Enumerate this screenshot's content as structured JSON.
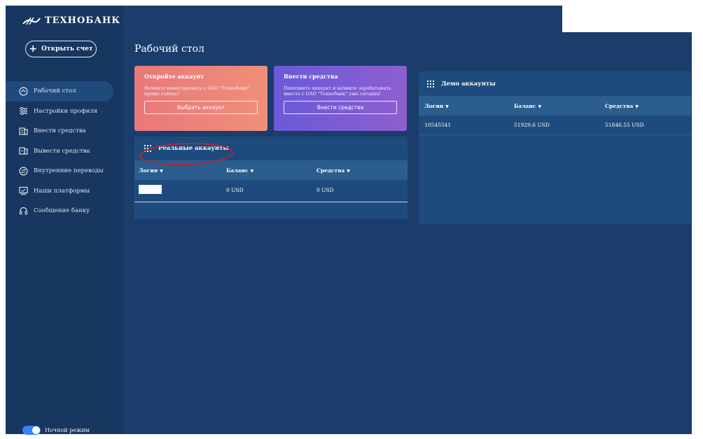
{
  "sidebar": {
    "logo": "ТЕХНОБАНК",
    "open_button": "Открыть счет",
    "items": [
      {
        "label": "Рабочий стол",
        "icon": "dashboard-icon"
      },
      {
        "label": "Настройки профиля",
        "icon": "sliders-icon"
      },
      {
        "label": "Внести средства",
        "icon": "deposit-icon"
      },
      {
        "label": "Вывести средства",
        "icon": "withdraw-icon"
      },
      {
        "label": "Внутренние переводы",
        "icon": "transfer-icon"
      },
      {
        "label": "Наши платформы",
        "icon": "platform-icon"
      },
      {
        "label": "Сообщение банку",
        "icon": "headset-icon"
      }
    ],
    "active_index": 0,
    "night_mode": {
      "label": "Ночной режим",
      "on": true
    }
  },
  "main": {
    "title": "Рабочий стол",
    "card_open": {
      "title": "Откройте аккаунт",
      "text": "Начните инвестировать с ОАО \"Технобанк\" прямо сейчас!",
      "button": "Выбрать аккаунт"
    },
    "card_deposit": {
      "title": "Внести средства",
      "text": "Пополните аккаунт и начните зарабатывать вместе с ОАО \"Технобанк\" уже сегодня!",
      "button": "Внести средства"
    },
    "real_accounts": {
      "title": "Реальные аккаунты",
      "columns": [
        "Логин",
        "Баланс",
        "Средства"
      ],
      "rows": [
        {
          "login": "",
          "balance": "0 USD",
          "funds": "0 USD"
        }
      ]
    },
    "demo_accounts": {
      "title": "Демо аккаунты",
      "columns": [
        "Логин",
        "Баланс",
        "Средства"
      ],
      "rows": [
        {
          "login": "10545541",
          "balance": "51929.6 USD",
          "funds": "51846.55 USD"
        }
      ]
    }
  },
  "colors": {
    "background": "#1b3d6b",
    "sidebar": "#173660",
    "panel": "#1e4b7d",
    "table_header": "#2b5d8e",
    "card_open": "#ee8479",
    "card_deposit": "#7b5dd4",
    "annotation_circle": "#b3263d",
    "toggle": "#3b82f6"
  }
}
